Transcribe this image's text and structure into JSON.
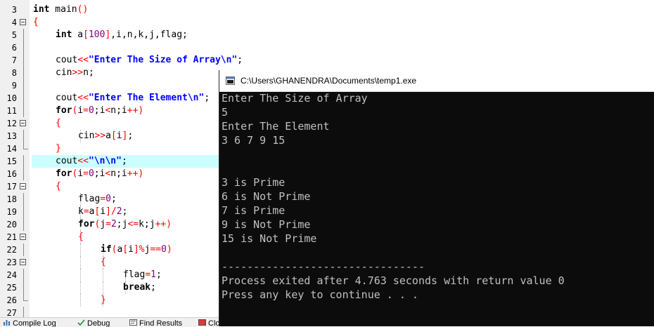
{
  "editor": {
    "lines": [
      {
        "n": "3",
        "fold": "",
        "indent": 0,
        "hl": false,
        "tokens": [
          [
            "kw",
            "int"
          ],
          [
            "p",
            " main"
          ],
          [
            "sym",
            "()"
          ]
        ]
      },
      {
        "n": "4",
        "fold": "open",
        "indent": 0,
        "hl": false,
        "tokens": [
          [
            "sym",
            "{"
          ]
        ]
      },
      {
        "n": "5",
        "fold": "v",
        "indent": 1,
        "hl": false,
        "tokens": [
          [
            "kw",
            "int"
          ],
          [
            "p",
            " a"
          ],
          [
            "sym",
            "["
          ],
          [
            "num",
            "100"
          ],
          [
            "sym",
            "]"
          ],
          [
            "p",
            ","
          ],
          [
            "p",
            "i"
          ],
          [
            "p",
            ","
          ],
          [
            "p",
            "n"
          ],
          [
            "p",
            ","
          ],
          [
            "p",
            "k"
          ],
          [
            "p",
            ","
          ],
          [
            "p",
            "j"
          ],
          [
            "p",
            ","
          ],
          [
            "p",
            "flag"
          ],
          [
            "p",
            ";"
          ]
        ]
      },
      {
        "n": "6",
        "fold": "v",
        "indent": 1,
        "hl": false,
        "tokens": []
      },
      {
        "n": "7",
        "fold": "v",
        "indent": 1,
        "hl": false,
        "tokens": [
          [
            "p",
            "cout"
          ],
          [
            "sym",
            "<<"
          ],
          [
            "str",
            "\"Enter The Size of Array\\n\""
          ],
          [
            "p",
            ";"
          ]
        ]
      },
      {
        "n": "8",
        "fold": "v",
        "indent": 1,
        "hl": false,
        "tokens": [
          [
            "p",
            "cin"
          ],
          [
            "sym",
            ">>"
          ],
          [
            "p",
            "n;"
          ]
        ]
      },
      {
        "n": "9",
        "fold": "v",
        "indent": 1,
        "hl": false,
        "tokens": []
      },
      {
        "n": "10",
        "fold": "v",
        "indent": 1,
        "hl": false,
        "tokens": [
          [
            "p",
            "cout"
          ],
          [
            "sym",
            "<<"
          ],
          [
            "str",
            "\"Enter The Element\\n\""
          ],
          [
            "p",
            ";"
          ]
        ]
      },
      {
        "n": "11",
        "fold": "v",
        "indent": 1,
        "hl": false,
        "tokens": [
          [
            "kw",
            "for"
          ],
          [
            "sym",
            "("
          ],
          [
            "p",
            "i"
          ],
          [
            "sym",
            "="
          ],
          [
            "num",
            "0"
          ],
          [
            "p",
            ";i"
          ],
          [
            "sym",
            "<"
          ],
          [
            "p",
            "n;i"
          ],
          [
            "sym",
            "++)"
          ]
        ]
      },
      {
        "n": "12",
        "fold": "open",
        "indent": 1,
        "hl": false,
        "tokens": [
          [
            "sym",
            "{"
          ]
        ]
      },
      {
        "n": "13",
        "fold": "v",
        "indent": 2,
        "hl": false,
        "tokens": [
          [
            "p",
            "cin"
          ],
          [
            "sym",
            ">>"
          ],
          [
            "p",
            "a"
          ],
          [
            "sym",
            "["
          ],
          [
            "p",
            "i"
          ],
          [
            "sym",
            "]"
          ],
          [
            "p",
            ";"
          ]
        ]
      },
      {
        "n": "14",
        "fold": "end",
        "indent": 1,
        "hl": false,
        "tokens": [
          [
            "sym",
            "}"
          ]
        ]
      },
      {
        "n": "15",
        "fold": "v",
        "indent": 1,
        "hl": true,
        "tokens": [
          [
            "p",
            "cout"
          ],
          [
            "sym",
            "<<"
          ],
          [
            "str",
            "\"\\n\\n\""
          ],
          [
            "p",
            ";"
          ]
        ]
      },
      {
        "n": "16",
        "fold": "v",
        "indent": 1,
        "hl": false,
        "tokens": [
          [
            "kw",
            "for"
          ],
          [
            "sym",
            "("
          ],
          [
            "p",
            "i"
          ],
          [
            "sym",
            "="
          ],
          [
            "num",
            "0"
          ],
          [
            "p",
            ";i"
          ],
          [
            "sym",
            "<"
          ],
          [
            "p",
            "n;i"
          ],
          [
            "sym",
            "++)"
          ]
        ]
      },
      {
        "n": "17",
        "fold": "open",
        "indent": 1,
        "hl": false,
        "tokens": [
          [
            "sym",
            "{"
          ]
        ]
      },
      {
        "n": "18",
        "fold": "v",
        "indent": 2,
        "hl": false,
        "tokens": [
          [
            "p",
            "flag"
          ],
          [
            "sym",
            "="
          ],
          [
            "num",
            "0"
          ],
          [
            "p",
            ";"
          ]
        ]
      },
      {
        "n": "19",
        "fold": "v",
        "indent": 2,
        "hl": false,
        "tokens": [
          [
            "p",
            "k"
          ],
          [
            "sym",
            "="
          ],
          [
            "p",
            "a"
          ],
          [
            "sym",
            "["
          ],
          [
            "p",
            "i"
          ],
          [
            "sym",
            "]/"
          ],
          [
            "num",
            "2"
          ],
          [
            "p",
            ";"
          ]
        ]
      },
      {
        "n": "20",
        "fold": "v",
        "indent": 2,
        "hl": false,
        "tokens": [
          [
            "kw",
            "for"
          ],
          [
            "sym",
            "("
          ],
          [
            "p",
            "j"
          ],
          [
            "sym",
            "="
          ],
          [
            "num",
            "2"
          ],
          [
            "p",
            ";j"
          ],
          [
            "sym",
            "<="
          ],
          [
            "p",
            "k;j"
          ],
          [
            "sym",
            "++)"
          ]
        ]
      },
      {
        "n": "21",
        "fold": "open",
        "indent": 2,
        "hl": false,
        "tokens": [
          [
            "sym",
            "{"
          ]
        ]
      },
      {
        "n": "22",
        "fold": "v",
        "indent": 3,
        "hl": false,
        "tokens": [
          [
            "kw",
            "if"
          ],
          [
            "sym",
            "("
          ],
          [
            "p",
            "a"
          ],
          [
            "sym",
            "["
          ],
          [
            "p",
            "i"
          ],
          [
            "sym",
            "]%"
          ],
          [
            "p",
            "j"
          ],
          [
            "sym",
            "=="
          ],
          [
            "num",
            "0"
          ],
          [
            "sym",
            ")"
          ]
        ]
      },
      {
        "n": "23",
        "fold": "open",
        "indent": 3,
        "hl": false,
        "tokens": [
          [
            "sym",
            "{"
          ]
        ]
      },
      {
        "n": "24",
        "fold": "v",
        "indent": 4,
        "hl": false,
        "tokens": [
          [
            "p",
            "flag"
          ],
          [
            "sym",
            "="
          ],
          [
            "num",
            "1"
          ],
          [
            "p",
            ";"
          ]
        ]
      },
      {
        "n": "25",
        "fold": "v",
        "indent": 4,
        "hl": false,
        "tokens": [
          [
            "kw",
            "break"
          ],
          [
            "p",
            ";"
          ]
        ]
      },
      {
        "n": "26",
        "fold": "end",
        "indent": 3,
        "hl": false,
        "tokens": [
          [
            "sym",
            "}"
          ]
        ]
      },
      {
        "n": "27",
        "fold": "v",
        "indent": 0,
        "hl": false,
        "tokens": []
      }
    ]
  },
  "console": {
    "title": "C:\\Users\\GHANENDRA\\Documents\\temp1.exe",
    "lines": [
      "Enter The Size of Array",
      "5",
      "Enter The Element",
      "3 6 7 9 15",
      "",
      "",
      "3 is Prime",
      "6 is Not Prime",
      "7 is Prime",
      "9 is Not Prime",
      "15 is Not Prime",
      "",
      "--------------------------------",
      "Process exited after 4.763 seconds with return value 0",
      "Press any key to continue . . ."
    ]
  },
  "bottom_tabs": [
    {
      "label": "Compile Log",
      "icon": "compile-log-icon"
    },
    {
      "label": "Debug",
      "icon": "debug-icon"
    },
    {
      "label": "Find Results",
      "icon": "find-results-icon"
    },
    {
      "label": "Close",
      "icon": "close-tab-icon"
    }
  ]
}
